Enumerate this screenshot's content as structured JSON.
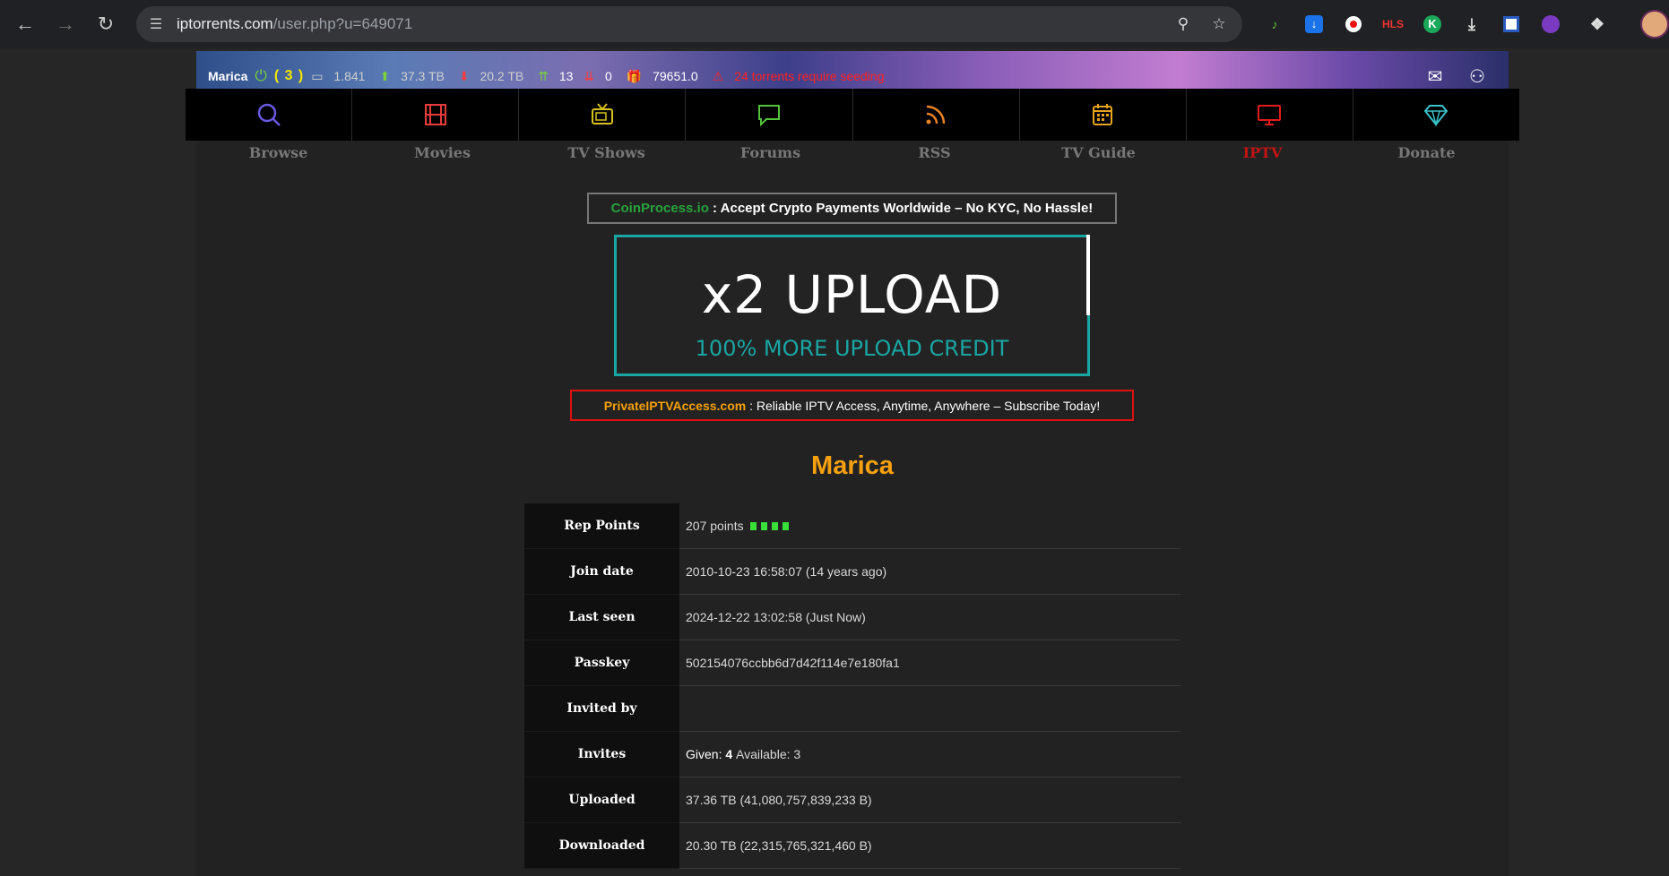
{
  "browser": {
    "url_host": "iptorrents.com",
    "url_path": "/user.php?u=649071",
    "ext_hls_label": "HLS"
  },
  "status": {
    "username": "Marica",
    "connections": "( 3 )",
    "ratio": "1.841",
    "uploaded": "37.3 TB",
    "downloaded": "20.2 TB",
    "seeding": "13",
    "leeching": "0",
    "bonus": "79651.0",
    "warning": "24 torrents require seeding"
  },
  "menu": [
    {
      "label": "Browse",
      "color": "#6a5ae0"
    },
    {
      "label": "Movies",
      "color": "#e63b3b"
    },
    {
      "label": "TV Shows",
      "color": "#d6c21a"
    },
    {
      "label": "Forums",
      "color": "#55c23a"
    },
    {
      "label": "RSS",
      "color": "#e8822a"
    },
    {
      "label": "TV Guide",
      "color": "#e8a41a"
    },
    {
      "label": "IPTV",
      "color": "#e21b1b"
    },
    {
      "label": "Donate",
      "color": "#3ac2c8"
    }
  ],
  "ads": {
    "coin_brand": "CoinProcess.io",
    "coin_text": " : Accept Crypto Payments Worldwide – No KYC, No Hassle!",
    "x2_big": "x2 UPLOAD",
    "x2_small": "100% MORE UPLOAD CREDIT",
    "iptv_brand": "PrivateIPTVAccess.com",
    "iptv_text": " : Reliable IPTV Access, Anytime, Anywhere – Subscribe Today!"
  },
  "profile": {
    "name": "Marica",
    "rows": [
      {
        "key": "Rep Points",
        "value": "207 points"
      },
      {
        "key": "Join date",
        "value": "2010-10-23 16:58:07 (14 years ago)"
      },
      {
        "key": "Last seen",
        "value": "2024-12-22 13:02:58 (Just Now)"
      },
      {
        "key": "Passkey",
        "value": "502154076ccbb6d7d42f114e7e180fa1"
      },
      {
        "key": "Invited by",
        "value": ""
      },
      {
        "key": "Invites",
        "given_label": "Given:",
        "given": "4",
        "available": "Available: 3"
      },
      {
        "key": "Uploaded",
        "value": "37.36 TB (41,080,757,839,233 B)"
      },
      {
        "key": "Downloaded",
        "value": "20.30 TB (22,315,765,321,460 B)"
      }
    ]
  }
}
